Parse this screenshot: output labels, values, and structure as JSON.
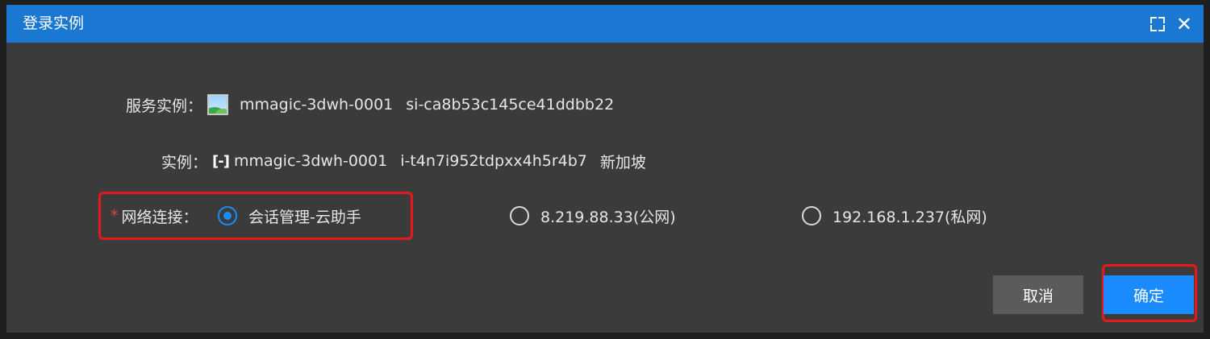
{
  "dialog": {
    "title": "登录实例"
  },
  "fields": {
    "service_instance": {
      "label": "服务实例：",
      "name": "mmagic-3dwh-0001",
      "id": "si-ca8b53c145ce41ddbb22"
    },
    "instance": {
      "label": "实例：",
      "name": "mmagic-3dwh-0001",
      "id": "i-t4n7i952tdpxx4h5r4b7",
      "region": "新加坡"
    },
    "network": {
      "required_mark": "*",
      "label": "网络连接：",
      "options": [
        {
          "label": "会话管理-云助手",
          "selected": true
        },
        {
          "label": "8.219.88.33(公网)",
          "selected": false
        },
        {
          "label": "192.168.1.237(私网)",
          "selected": false
        }
      ]
    }
  },
  "buttons": {
    "cancel": "取消",
    "ok": "确定"
  },
  "colors": {
    "titlebar": "#1a77d2",
    "dialog_bg": "#3b3b3b",
    "primary": "#1a8cff",
    "highlight": "#e8171b"
  },
  "icons": {
    "service_instance": "image-icon",
    "instance": "ecs-instance-icon",
    "window": [
      "maximize-icon",
      "close-icon"
    ]
  }
}
